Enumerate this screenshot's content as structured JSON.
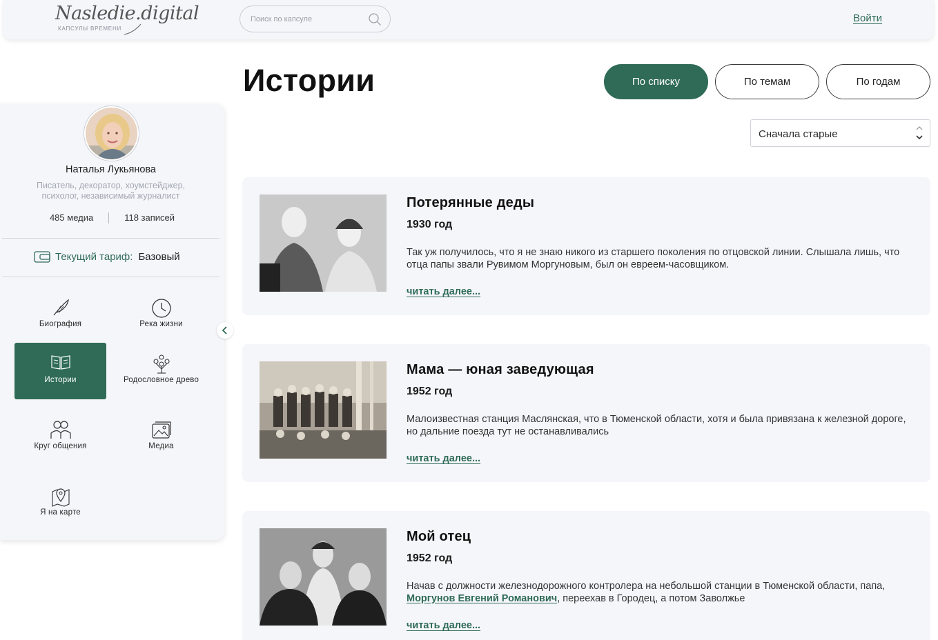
{
  "header": {
    "logo_text": "Nasledie.digital",
    "logo_subtitle": "КАПСУЛЫ ВРЕМЕНИ",
    "search_placeholder": "Поиск по капсуле",
    "login_label": "Войти"
  },
  "page": {
    "title": "Истории",
    "view_buttons": [
      {
        "label": "По списку",
        "active": true
      },
      {
        "label": "По темам",
        "active": false
      },
      {
        "label": "По годам",
        "active": false
      }
    ],
    "sort_selected": "Сначала старые"
  },
  "profile": {
    "name": "Наталья Лукьянова",
    "description": "Писатель, декоратор, хоумстейджер, психолог, независимый журналист",
    "media_count": "485 медиа",
    "records_count": "118 записей",
    "tariff_label": "Текущий тариф:",
    "tariff_value": "Базовый"
  },
  "sidebar_nav": [
    {
      "label": "Биография",
      "icon": "feather-icon",
      "active": false
    },
    {
      "label": "Река жизни",
      "icon": "clock-icon",
      "active": false
    },
    {
      "label": "Истории",
      "icon": "book-icon",
      "active": true
    },
    {
      "label": "Родословное древо",
      "icon": "family-tree-icon",
      "active": false
    },
    {
      "label": "Круг общения",
      "icon": "people-icon",
      "active": false
    },
    {
      "label": "Медиа",
      "icon": "photos-icon",
      "active": false
    },
    {
      "label": "Я на карте",
      "icon": "map-pin-icon",
      "active": false
    }
  ],
  "stories": [
    {
      "title": "Потерянные деды",
      "year": "1930 год",
      "excerpt": "Так уж получилось, что я не знаю никого из старшего поколения по отцовской линии. Слышала лишь, что отца папы звали Рувимом Моргуновым, был он евреем-часовщиком.",
      "more": "читать далее..."
    },
    {
      "title": "Мама — юная заведующая",
      "year": "1952 год",
      "excerpt": "Малоизвестная станция Маслянская, что в Тюменской области, хотя и была привязана к железной дороге, но дальние поезда тут не останавливались",
      "more": "читать далее..."
    },
    {
      "title": "Мой отец",
      "year": "1952 год",
      "excerpt_before": "Начав с должности железнодорожного контролера на небольшой станции в Тюменской области, папа, ",
      "excerpt_link": "Моргунов Евгений Романович",
      "excerpt_after": ", переехав в Городец, а потом Заволжье",
      "more": "читать далее..."
    }
  ],
  "colors": {
    "accent": "#2f6b56",
    "panel": "#f5f6fa",
    "muted_text": "#a3a8b2"
  }
}
